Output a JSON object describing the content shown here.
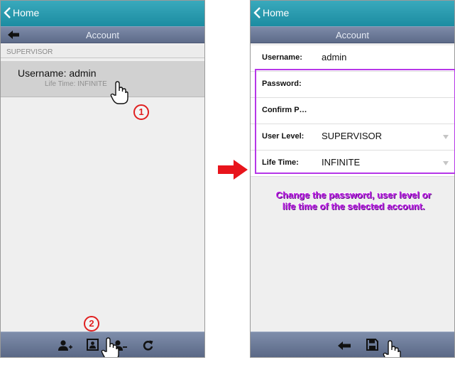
{
  "left": {
    "home_label": "Home",
    "title": "Account",
    "section_header": "SUPERVISOR",
    "account": {
      "main": "Username: admin",
      "sub": "Life Time: INFINITE"
    },
    "marker1": "1",
    "marker2": "2",
    "toolbar": [
      "add-user-icon",
      "edit-user-icon",
      "delete-user-icon",
      "refresh-icon"
    ]
  },
  "right": {
    "home_label": "Home",
    "title": "Account",
    "fields": [
      {
        "label": "Username:",
        "value": "admin",
        "dropdown": false
      },
      {
        "label": "Password:",
        "value": "",
        "dropdown": false
      },
      {
        "label": "Confirm P…",
        "value": "",
        "dropdown": false
      },
      {
        "label": "User Level:",
        "value": "SUPERVISOR",
        "dropdown": true
      },
      {
        "label": "Life Time:",
        "value": "INFINITE",
        "dropdown": true
      }
    ],
    "note": "Change the password, user level or life time of the selected account.",
    "toolbar": [
      "back-icon",
      "save-icon"
    ]
  },
  "colors": {
    "topbar": "#2a9db1",
    "subbar": "#6d7a98",
    "highlight": "#b636e8",
    "marker": "#e02020"
  }
}
